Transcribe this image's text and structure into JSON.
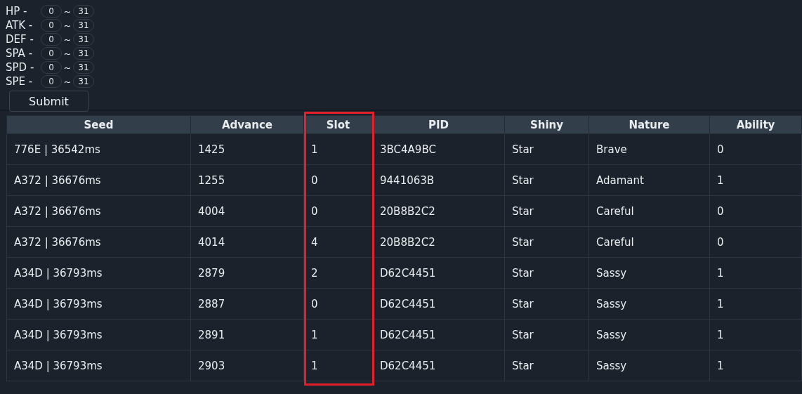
{
  "filters": [
    {
      "label": "HP -",
      "min": "0",
      "sep": "~",
      "max": "31"
    },
    {
      "label": "ATK -",
      "min": "0",
      "sep": "~",
      "max": "31"
    },
    {
      "label": "DEF -",
      "min": "0",
      "sep": "~",
      "max": "31"
    },
    {
      "label": "SPA -",
      "min": "0",
      "sep": "~",
      "max": "31"
    },
    {
      "label": "SPD -",
      "min": "0",
      "sep": "~",
      "max": "31"
    },
    {
      "label": "SPE -",
      "min": "0",
      "sep": "~",
      "max": "31"
    }
  ],
  "submit": "Submit",
  "table": {
    "columns": [
      {
        "label": "Seed",
        "highlighted": false
      },
      {
        "label": "Advance",
        "highlighted": false
      },
      {
        "label": "Slot",
        "highlighted": true
      },
      {
        "label": "PID",
        "highlighted": false
      },
      {
        "label": "Shiny",
        "highlighted": false
      },
      {
        "label": "Nature",
        "highlighted": false
      },
      {
        "label": "Ability",
        "highlighted": false
      }
    ],
    "rows": [
      [
        "776E | 36542ms",
        "1425",
        "1",
        "3BC4A9BC",
        "Star",
        "Brave",
        "0"
      ],
      [
        "A372 | 36676ms",
        "1255",
        "0",
        "9441063B",
        "Star",
        "Adamant",
        "1"
      ],
      [
        "A372 | 36676ms",
        "4004",
        "0",
        "20B8B2C2",
        "Star",
        "Careful",
        "0"
      ],
      [
        "A372 | 36676ms",
        "4014",
        "4",
        "20B8B2C2",
        "Star",
        "Careful",
        "0"
      ],
      [
        "A34D | 36793ms",
        "2879",
        "2",
        "D62C4451",
        "Star",
        "Sassy",
        "1"
      ],
      [
        "A34D | 36793ms",
        "2887",
        "0",
        "D62C4451",
        "Star",
        "Sassy",
        "1"
      ],
      [
        "A34D | 36793ms",
        "2891",
        "1",
        "D62C4451",
        "Star",
        "Sassy",
        "1"
      ],
      [
        "A34D | 36793ms",
        "2903",
        "1",
        "D62C4451",
        "Star",
        "Sassy",
        "1"
      ]
    ]
  }
}
